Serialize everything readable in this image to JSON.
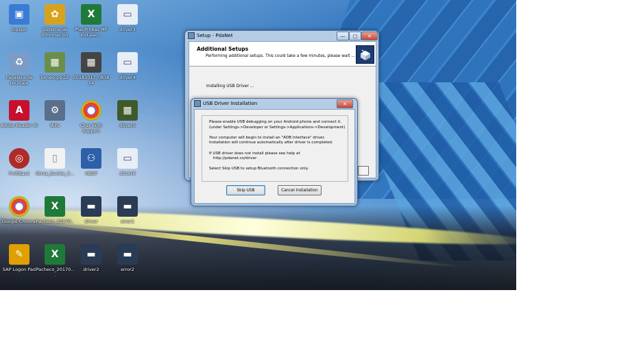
{
  "desktop": {
    "icons": [
      {
        "label": "Equipo",
        "glyph": "▣",
        "color": "#3a7bd5"
      },
      {
        "label": "Sistema de Información",
        "glyph": "✿",
        "color": "#d9a21b"
      },
      {
        "label": "PlanProbas MP Instalac...",
        "glyph": "X",
        "color": "#1f7a3a"
      },
      {
        "label": "driver3",
        "glyph": "▭",
        "color": "#e8eef6"
      },
      {
        "label": "Papelera de reciclaje",
        "glyph": "♻",
        "color": "#7a9cc6"
      },
      {
        "label": "Torneo-pp-DF",
        "glyph": "▦",
        "color": "#6b8f4a"
      },
      {
        "label": "20181017_083814",
        "glyph": "▦",
        "color": "#444"
      },
      {
        "label": "driver4",
        "glyph": "▭",
        "color": "#e8eef6"
      },
      {
        "label": "Adobe Reader XI",
        "glyph": "A",
        "color": "#c8102e"
      },
      {
        "label": "lAPa",
        "glyph": "⚙",
        "color": "#5a6f8a"
      },
      {
        "label": "Chat With Support",
        "glyph": "●",
        "color": "#2f9e44"
      },
      {
        "label": "driver5",
        "glyph": "▦",
        "color": "#3f5a2a"
      },
      {
        "label": "ProfiBac2",
        "glyph": "◎",
        "color": "#b02a2a"
      },
      {
        "label": "Otras_Bucles_3...",
        "glyph": "▯",
        "color": "#f2f2f2"
      },
      {
        "label": "VBDP",
        "glyph": "⚇",
        "color": "#2e5fa8"
      },
      {
        "label": "driver6",
        "glyph": "▭",
        "color": "#e8eef6"
      },
      {
        "label": "Google Chrome",
        "glyph": "●",
        "color": "#2f9e44"
      },
      {
        "label": "Pacheco_20170...",
        "glyph": "X",
        "color": "#1f7a3a"
      },
      {
        "label": "driver",
        "glyph": "▬",
        "color": "#2a3b55"
      },
      {
        "label": "error1",
        "glyph": "▬",
        "color": "#2a3b55"
      },
      {
        "label": "SAP Logon Pad",
        "glyph": "✎",
        "color": "#e0a000"
      },
      {
        "label": "Pacheco_20170...",
        "glyph": "X",
        "color": "#1f7a3a"
      },
      {
        "label": "driver2",
        "glyph": "▬",
        "color": "#2a3b55"
      },
      {
        "label": "error2",
        "glyph": "▬",
        "color": "#2a3b55"
      }
    ]
  },
  "setup_window": {
    "title": "Setup - PdaNet",
    "header_title": "Additional Setups",
    "header_subtitle": "Performing additional setups. This could take a few minutes, please wait ...",
    "status": "Installing USB Driver ..."
  },
  "usb_dialog": {
    "title": "USB Driver Installation",
    "lines": [
      "Please enable USB debugging on your Android phone and connect it.",
      "(under Settings->Developer or Settings->Applications->Development)",
      "",
      "Your computer will begin to install an \"ADB Interface\" driver.",
      "Installation will continue automatically after driver is completed.",
      "",
      "If USB driver does not install please see help at",
      "http://pdanet.co/driver",
      "",
      "Select Skip USB to setup Bluetooth connection only."
    ],
    "skip_button": "Skip USB",
    "cancel_button": "Cancel Installation"
  },
  "window_controls": {
    "minimize": "—",
    "maximize": "□",
    "close": "✕"
  }
}
